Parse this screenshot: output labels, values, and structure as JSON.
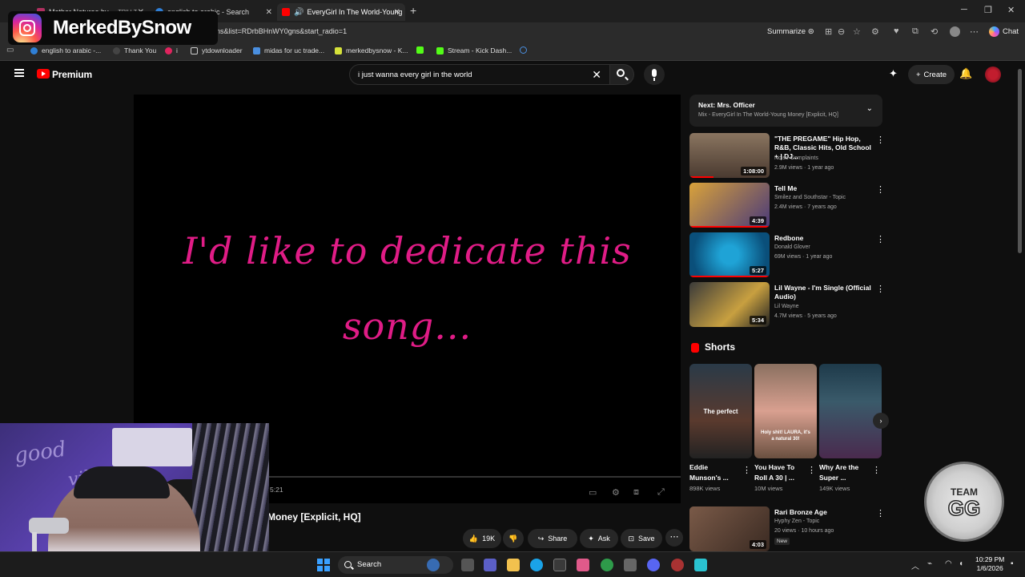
{
  "browser": {
    "tabs": [
      {
        "title": "Mother Naturee by",
        "extra": "TRILLZ"
      },
      {
        "title": "english to arabic - Search"
      },
      {
        "title": "EveryGirl In The World-Young"
      }
    ],
    "url": "ns&list=RDrbBHnWY0gns&start_radio=1",
    "summarize_label": "Summarize",
    "chat_label": "Chat",
    "bookmarks": [
      "english to arabic -...",
      "Thank You",
      "i",
      "ytdownloader",
      "midas for uc trade...",
      "merkedbysnow - K...",
      "Stream - Kick Dash..."
    ]
  },
  "youtube": {
    "brand": "Premium",
    "search_query": "i just wanna every girl in the world",
    "create_label": "Create",
    "player": {
      "lyric_line1": "I'd like to dedicate this",
      "lyric_line2": "song...",
      "timecode": "5:21",
      "progress_fraction": 0.02
    },
    "video_title": "Money [Explicit, HQ]",
    "actions": {
      "likes": "19K",
      "share": "Share",
      "ask": "Ask",
      "save": "Save"
    },
    "next": {
      "label": "Next: Mrs. Officer",
      "mix": "Mix - EveryGirl In The World-Young Money [Explicit, HQ]"
    },
    "recommendations": [
      {
        "title": "\"THE PREGAME\" Hip Hop, R&B, Classic Hits, Old School + | DJ...",
        "channel": "Noise Complaints",
        "meta": "2.9M views · 1 year ago",
        "duration": "1:08:00",
        "thumb": "#6e5a4a"
      },
      {
        "title": "Tell Me",
        "channel": "Smilez and Southstar - Topic",
        "meta": "2.4M views · 7 years ago",
        "duration": "4:39",
        "thumb": "#c18a2d"
      },
      {
        "title": "Redbone",
        "channel": "Donald Glover",
        "meta": "69M views · 1 year ago",
        "duration": "5:27",
        "thumb": "#0f6fa8"
      },
      {
        "title": "Lil Wayne - I'm Single (Official Audio)",
        "channel": "Lil Wayne",
        "meta": "4.7M views · 5 years ago",
        "duration": "5:34",
        "thumb": "#2b2b2b"
      }
    ],
    "shorts_heading": "Shorts",
    "shorts": [
      {
        "title": "Eddie Munson's ...",
        "views": "898K views",
        "caption": "The perfect"
      },
      {
        "title": "You Have To Roll A 30 | ...",
        "views": "10M views",
        "caption": "Holy shit! LAURA, it's a natural 30!"
      },
      {
        "title": "Why Are the Super ...",
        "views": "149K views",
        "caption": ""
      }
    ],
    "last_rec": {
      "title": "Rari Bronze Age",
      "channel": "Hyphy Zen - Topic",
      "meta": "20 views · 10 hours ago",
      "badge": "New",
      "duration": "4:03"
    }
  },
  "overlays": {
    "instagram_handle": "MerkedBySnow",
    "webcam_sign": [
      "good",
      "vibes"
    ],
    "team_badge": [
      "TEAM",
      "GG"
    ]
  },
  "taskbar": {
    "search_label": "Search",
    "time": "10:29 PM",
    "date": "1/6/2026"
  }
}
